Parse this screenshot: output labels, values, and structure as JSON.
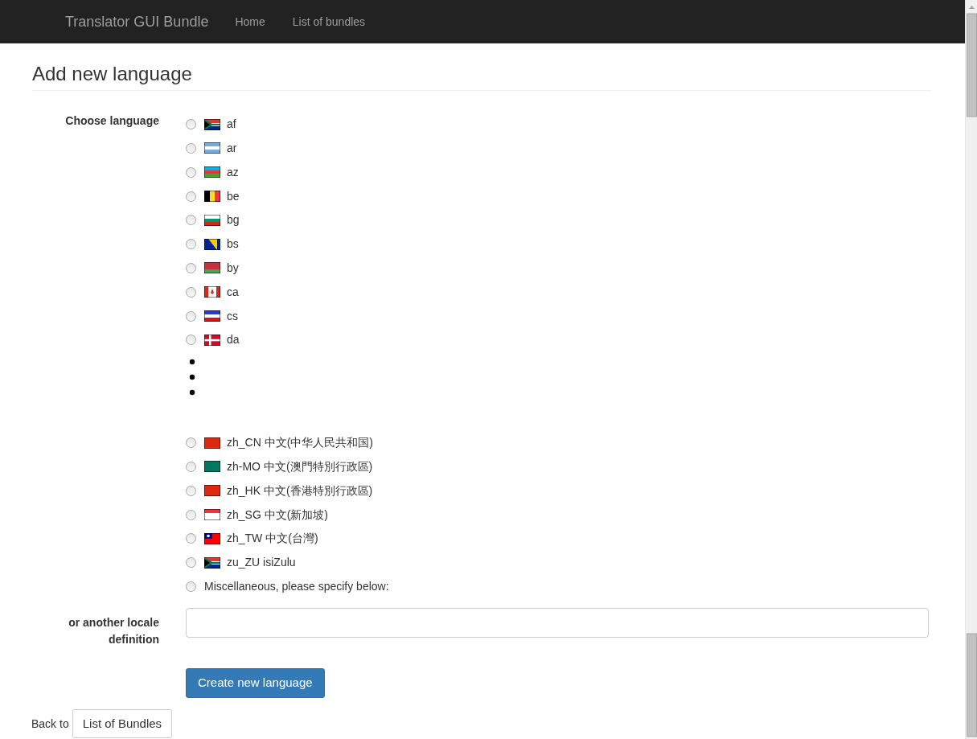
{
  "navbar": {
    "brand": "Translator GUI Bundle",
    "links": [
      {
        "label": "Home",
        "selected": false
      },
      {
        "label": "List of bundles",
        "selected": false
      }
    ]
  },
  "heading": "Add new language",
  "language_field": {
    "label": "Choose language",
    "languages_start": [
      {
        "label": "af",
        "selected": false
      },
      {
        "label": "ar",
        "selected": false
      },
      {
        "label": "az",
        "selected": false
      },
      {
        "label": "be",
        "selected": false
      },
      {
        "label": "bg",
        "selected": false
      },
      {
        "label": "bs",
        "selected": false
      },
      {
        "label": "by",
        "selected": false
      },
      {
        "label": "ca",
        "selected": false
      },
      {
        "label": "cs",
        "selected": false
      },
      {
        "label": "da",
        "selected": false
      }
    ],
    "languages_end": [
      {
        "label": "zh_CN 中文(中华人民共和国)",
        "selected": false
      },
      {
        "label": "zh-MO 中文(澳門特別行政區)",
        "selected": false
      },
      {
        "label": "zh_HK 中文(香港特別行政區)",
        "selected": false
      },
      {
        "label": "zh_SG 中文(新加坡)",
        "selected": false
      },
      {
        "label": "zh_TW 中文(台灣)",
        "selected": false
      },
      {
        "label": "zu_ZU isiZulu",
        "selected": false
      },
      {
        "label": "Miscellaneous, please specify below:",
        "selected": false,
        "kind": "plain"
      }
    ]
  },
  "locale_field": {
    "label": "or another locale definition"
  },
  "submit_button": "Create new language",
  "back": {
    "text": "Back to",
    "button": "List of Bundles"
  }
}
